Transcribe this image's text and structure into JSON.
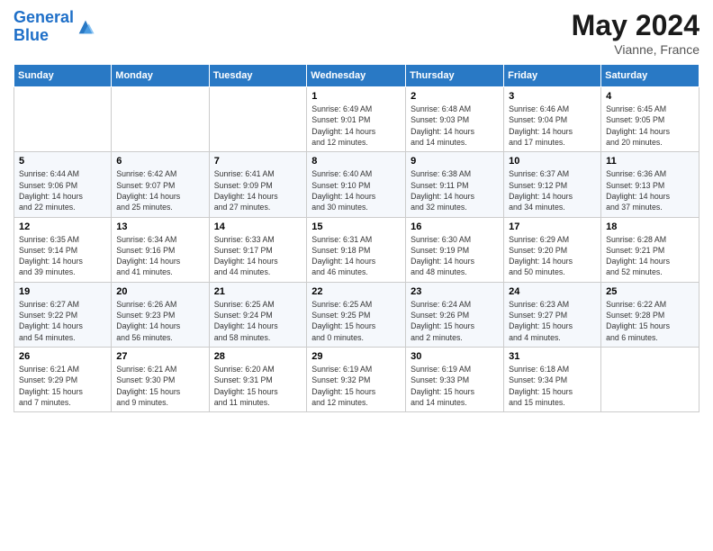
{
  "header": {
    "logo_line1": "General",
    "logo_line2": "Blue",
    "month_year": "May 2024",
    "location": "Vianne, France"
  },
  "days_of_week": [
    "Sunday",
    "Monday",
    "Tuesday",
    "Wednesday",
    "Thursday",
    "Friday",
    "Saturday"
  ],
  "weeks": [
    [
      {
        "num": "",
        "info": ""
      },
      {
        "num": "",
        "info": ""
      },
      {
        "num": "",
        "info": ""
      },
      {
        "num": "1",
        "info": "Sunrise: 6:49 AM\nSunset: 9:01 PM\nDaylight: 14 hours\nand 12 minutes."
      },
      {
        "num": "2",
        "info": "Sunrise: 6:48 AM\nSunset: 9:03 PM\nDaylight: 14 hours\nand 14 minutes."
      },
      {
        "num": "3",
        "info": "Sunrise: 6:46 AM\nSunset: 9:04 PM\nDaylight: 14 hours\nand 17 minutes."
      },
      {
        "num": "4",
        "info": "Sunrise: 6:45 AM\nSunset: 9:05 PM\nDaylight: 14 hours\nand 20 minutes."
      }
    ],
    [
      {
        "num": "5",
        "info": "Sunrise: 6:44 AM\nSunset: 9:06 PM\nDaylight: 14 hours\nand 22 minutes."
      },
      {
        "num": "6",
        "info": "Sunrise: 6:42 AM\nSunset: 9:07 PM\nDaylight: 14 hours\nand 25 minutes."
      },
      {
        "num": "7",
        "info": "Sunrise: 6:41 AM\nSunset: 9:09 PM\nDaylight: 14 hours\nand 27 minutes."
      },
      {
        "num": "8",
        "info": "Sunrise: 6:40 AM\nSunset: 9:10 PM\nDaylight: 14 hours\nand 30 minutes."
      },
      {
        "num": "9",
        "info": "Sunrise: 6:38 AM\nSunset: 9:11 PM\nDaylight: 14 hours\nand 32 minutes."
      },
      {
        "num": "10",
        "info": "Sunrise: 6:37 AM\nSunset: 9:12 PM\nDaylight: 14 hours\nand 34 minutes."
      },
      {
        "num": "11",
        "info": "Sunrise: 6:36 AM\nSunset: 9:13 PM\nDaylight: 14 hours\nand 37 minutes."
      }
    ],
    [
      {
        "num": "12",
        "info": "Sunrise: 6:35 AM\nSunset: 9:14 PM\nDaylight: 14 hours\nand 39 minutes."
      },
      {
        "num": "13",
        "info": "Sunrise: 6:34 AM\nSunset: 9:16 PM\nDaylight: 14 hours\nand 41 minutes."
      },
      {
        "num": "14",
        "info": "Sunrise: 6:33 AM\nSunset: 9:17 PM\nDaylight: 14 hours\nand 44 minutes."
      },
      {
        "num": "15",
        "info": "Sunrise: 6:31 AM\nSunset: 9:18 PM\nDaylight: 14 hours\nand 46 minutes."
      },
      {
        "num": "16",
        "info": "Sunrise: 6:30 AM\nSunset: 9:19 PM\nDaylight: 14 hours\nand 48 minutes."
      },
      {
        "num": "17",
        "info": "Sunrise: 6:29 AM\nSunset: 9:20 PM\nDaylight: 14 hours\nand 50 minutes."
      },
      {
        "num": "18",
        "info": "Sunrise: 6:28 AM\nSunset: 9:21 PM\nDaylight: 14 hours\nand 52 minutes."
      }
    ],
    [
      {
        "num": "19",
        "info": "Sunrise: 6:27 AM\nSunset: 9:22 PM\nDaylight: 14 hours\nand 54 minutes."
      },
      {
        "num": "20",
        "info": "Sunrise: 6:26 AM\nSunset: 9:23 PM\nDaylight: 14 hours\nand 56 minutes."
      },
      {
        "num": "21",
        "info": "Sunrise: 6:25 AM\nSunset: 9:24 PM\nDaylight: 14 hours\nand 58 minutes."
      },
      {
        "num": "22",
        "info": "Sunrise: 6:25 AM\nSunset: 9:25 PM\nDaylight: 15 hours\nand 0 minutes."
      },
      {
        "num": "23",
        "info": "Sunrise: 6:24 AM\nSunset: 9:26 PM\nDaylight: 15 hours\nand 2 minutes."
      },
      {
        "num": "24",
        "info": "Sunrise: 6:23 AM\nSunset: 9:27 PM\nDaylight: 15 hours\nand 4 minutes."
      },
      {
        "num": "25",
        "info": "Sunrise: 6:22 AM\nSunset: 9:28 PM\nDaylight: 15 hours\nand 6 minutes."
      }
    ],
    [
      {
        "num": "26",
        "info": "Sunrise: 6:21 AM\nSunset: 9:29 PM\nDaylight: 15 hours\nand 7 minutes."
      },
      {
        "num": "27",
        "info": "Sunrise: 6:21 AM\nSunset: 9:30 PM\nDaylight: 15 hours\nand 9 minutes."
      },
      {
        "num": "28",
        "info": "Sunrise: 6:20 AM\nSunset: 9:31 PM\nDaylight: 15 hours\nand 11 minutes."
      },
      {
        "num": "29",
        "info": "Sunrise: 6:19 AM\nSunset: 9:32 PM\nDaylight: 15 hours\nand 12 minutes."
      },
      {
        "num": "30",
        "info": "Sunrise: 6:19 AM\nSunset: 9:33 PM\nDaylight: 15 hours\nand 14 minutes."
      },
      {
        "num": "31",
        "info": "Sunrise: 6:18 AM\nSunset: 9:34 PM\nDaylight: 15 hours\nand 15 minutes."
      },
      {
        "num": "",
        "info": ""
      }
    ]
  ]
}
